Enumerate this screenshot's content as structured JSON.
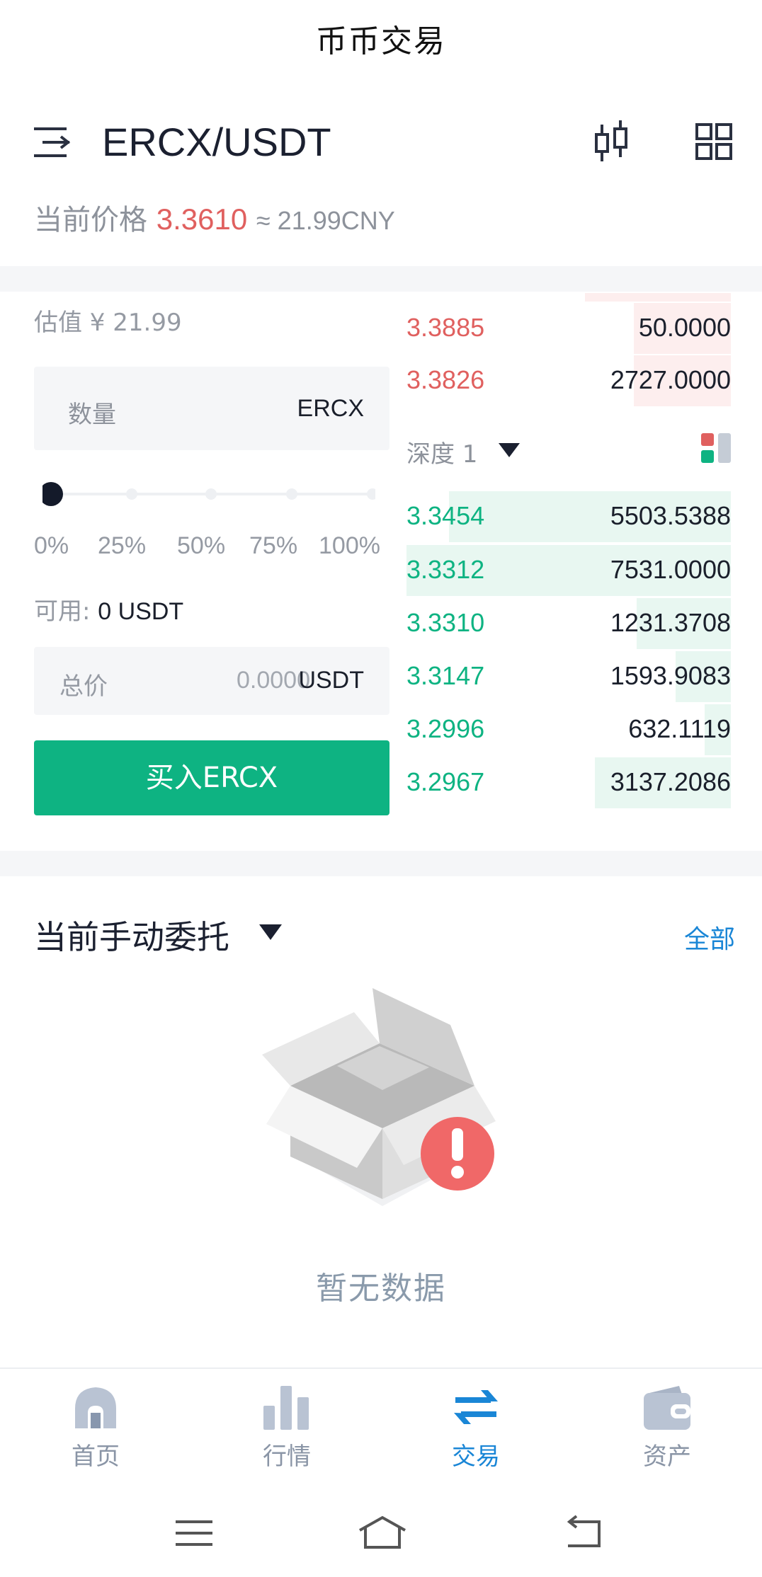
{
  "header": {
    "title": "币币交易"
  },
  "pair_bar": {
    "pair": "ERCX/USDT"
  },
  "price": {
    "label": "当前价格",
    "value": "3.3610",
    "approx": "≈ 21.99CNY"
  },
  "order_form": {
    "estimate": "估值 ¥ 21.99",
    "quantity": {
      "placeholder": "数量",
      "unit": "ERCX"
    },
    "slider": {
      "value": 0,
      "labels": [
        "0%",
        "25%",
        "50%",
        "75%",
        "100%"
      ]
    },
    "available_label": "可用:",
    "available_value": "0 USDT",
    "total": {
      "label": "总价",
      "value": "0.0000",
      "unit": "USDT"
    },
    "buy_button": "买入ERCX",
    "colors": {
      "buy": "#0eb382",
      "sell": "#e0605f"
    }
  },
  "order_book": {
    "asks": [
      {
        "price": "3.3885",
        "amount": "50.0000",
        "depth": 0.3
      },
      {
        "price": "3.3826",
        "amount": "2727.0000",
        "depth": 0.3
      }
    ],
    "depth_label": "深度 1",
    "bids": [
      {
        "price": "3.3454",
        "amount": "5503.5388",
        "depth": 0.87
      },
      {
        "price": "3.3312",
        "amount": "7531.0000",
        "depth": 1.0
      },
      {
        "price": "3.3310",
        "amount": "1231.3708",
        "depth": 0.29
      },
      {
        "price": "3.3147",
        "amount": "1593.9083",
        "depth": 0.17
      },
      {
        "price": "3.2996",
        "amount": "632.1119",
        "depth": 0.08
      },
      {
        "price": "3.2967",
        "amount": "3137.2086",
        "depth": 0.42
      }
    ]
  },
  "orders": {
    "title": "当前手动委托",
    "all_link": "全部",
    "empty_text": "暂无数据"
  },
  "tabbar": {
    "items": [
      {
        "label": "首页",
        "icon": "home-icon"
      },
      {
        "label": "行情",
        "icon": "chart-bars-icon"
      },
      {
        "label": "交易",
        "icon": "swap-arrows-icon",
        "active": true
      },
      {
        "label": "资产",
        "icon": "wallet-icon"
      }
    ],
    "active_color": "#1a86d6"
  }
}
